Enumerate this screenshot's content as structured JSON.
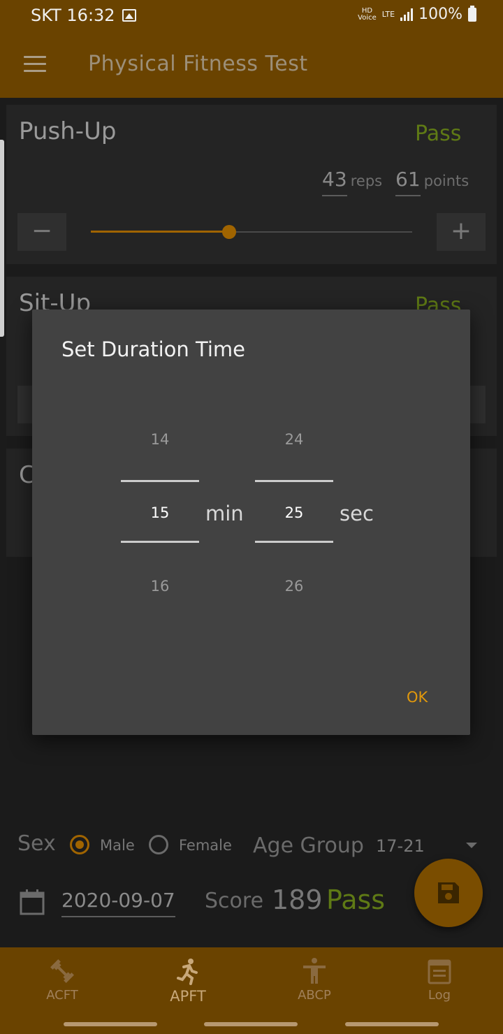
{
  "status_bar": {
    "carrier_time": "SKT 16:32",
    "hd": "HD",
    "hd_sub": "Voice",
    "lte": "LTE",
    "battery": "100%"
  },
  "app_bar": {
    "title": "Physical Fitness Test",
    "menu_icon": "menu-icon"
  },
  "pushup": {
    "title": "Push-Up",
    "status": "Pass",
    "reps_value": "43",
    "reps_unit": "reps",
    "points_value": "61",
    "points_unit": "points",
    "minus": "−",
    "plus": "+",
    "slider_fraction": 0.43
  },
  "situp": {
    "title": "Sit-Up",
    "status": "Pass"
  },
  "run": {
    "title_partial": "C"
  },
  "dialog": {
    "title": "Set Duration Time",
    "minutes": {
      "prev": "14",
      "current": "15",
      "next": "16",
      "unit": "min"
    },
    "seconds": {
      "prev": "24",
      "current": "25",
      "next": "26",
      "unit": "sec"
    },
    "ok_label": "OK"
  },
  "profile": {
    "sex_label": "Sex",
    "male_label": "Male",
    "female_label": "Female",
    "selected": "Male",
    "age_group_label": "Age Group",
    "age_group_value": "17-21"
  },
  "summary": {
    "date": "2020-09-07",
    "score_label": "Score",
    "score_value": "189",
    "result": "Pass"
  },
  "bottom_nav": [
    {
      "label": "ACFT",
      "icon": "dumbbell-icon",
      "active": false
    },
    {
      "label": "APFT",
      "icon": "running-icon",
      "active": true
    },
    {
      "label": "ABCP",
      "icon": "person-icon",
      "active": false
    },
    {
      "label": "Log",
      "icon": "log-icon",
      "active": false
    }
  ],
  "colors": {
    "accent": "#a06400",
    "pass": "#5f7a15",
    "appbar": "#6a4300",
    "dialog": "#424242",
    "ok": "#e0980c"
  }
}
